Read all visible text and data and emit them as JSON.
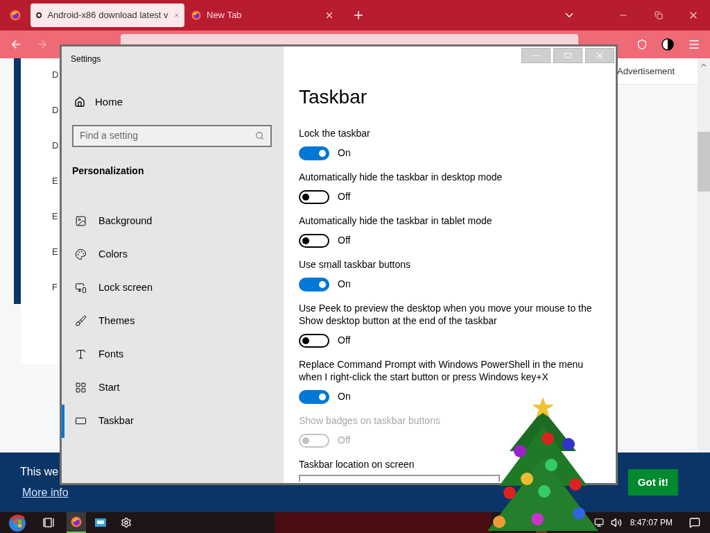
{
  "browser": {
    "tabs": [
      {
        "title": "Android-x86 download latest v",
        "selected": true
      },
      {
        "title": "New Tab",
        "selected": false
      }
    ],
    "page": {
      "list_letters": [
        "D",
        "D",
        "D",
        "E",
        "E",
        "E",
        "F"
      ],
      "advertisement": "Advertisement",
      "cookie_bar": {
        "text": "This we",
        "link": "More info",
        "button": "Got it!"
      }
    }
  },
  "settings": {
    "title": "Settings",
    "home": "Home",
    "search": {
      "placeholder": "Find a setting"
    },
    "section": "Personalization",
    "nav": [
      {
        "label": "Background",
        "selected": false
      },
      {
        "label": "Colors",
        "selected": false
      },
      {
        "label": "Lock screen",
        "selected": false
      },
      {
        "label": "Themes",
        "selected": false
      },
      {
        "label": "Fonts",
        "selected": false
      },
      {
        "label": "Start",
        "selected": false
      },
      {
        "label": "Taskbar",
        "selected": true
      }
    ],
    "heading": "Taskbar",
    "options": [
      {
        "kind": "toggle",
        "label": "Lock the taskbar",
        "on": true,
        "disabled": false,
        "state_text": "On"
      },
      {
        "kind": "toggle",
        "label": "Automatically hide the taskbar in desktop mode",
        "on": false,
        "disabled": false,
        "state_text": "Off"
      },
      {
        "kind": "toggle",
        "label": "Automatically hide the taskbar in tablet mode",
        "on": false,
        "disabled": false,
        "state_text": "Off"
      },
      {
        "kind": "toggle",
        "label": "Use small taskbar buttons",
        "on": true,
        "disabled": false,
        "state_text": "On"
      },
      {
        "kind": "toggle",
        "label": "Use Peek to preview the desktop when you move your mouse to the Show desktop button at the end of the taskbar",
        "on": false,
        "disabled": false,
        "state_text": "Off"
      },
      {
        "kind": "toggle",
        "label": "Replace Command Prompt with Windows PowerShell in the menu when I right-click the start button or press Windows key+X",
        "on": true,
        "disabled": false,
        "state_text": "On"
      },
      {
        "kind": "toggle",
        "label": "Show badges on taskbar buttons",
        "on": false,
        "disabled": true,
        "state_text": "Off"
      },
      {
        "kind": "dropdown",
        "label": "Taskbar location on screen"
      }
    ]
  },
  "taskbar": {
    "clock": "8:47:07 PM"
  }
}
